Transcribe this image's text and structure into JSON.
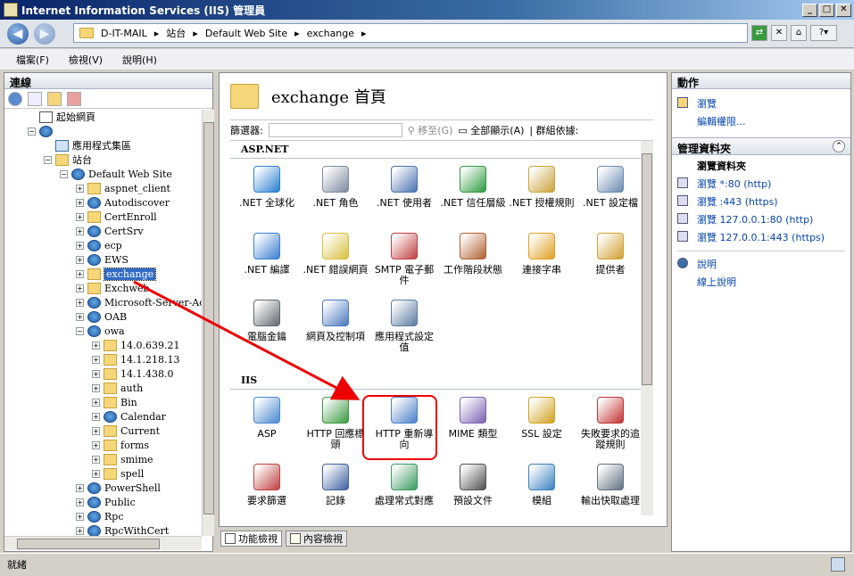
{
  "window": {
    "title": "Internet Information Services (IIS) 管理員",
    "controls": [
      "_",
      "□",
      "✕"
    ]
  },
  "breadcrumb": [
    "D-IT-MAIL",
    "站台",
    "Default Web Site",
    "exchange"
  ],
  "menu": [
    "檔案(F)",
    "檢視(V)",
    "說明(H)"
  ],
  "connections": {
    "title": "連線",
    "tree": [
      {
        "label": "起始網頁",
        "icon": "home",
        "level": 1,
        "exp": ""
      },
      {
        "label": "",
        "icon": "web",
        "level": 1,
        "exp": "−"
      },
      {
        "label": "應用程式集區",
        "icon": "pool",
        "level": 2,
        "exp": ""
      },
      {
        "label": "站台",
        "icon": "fold",
        "level": 2,
        "exp": "−"
      },
      {
        "label": "Default Web Site",
        "icon": "web",
        "level": 3,
        "exp": "−"
      },
      {
        "label": "aspnet_client",
        "icon": "fold",
        "level": 4,
        "exp": "+"
      },
      {
        "label": "Autodiscover",
        "icon": "web",
        "level": 4,
        "exp": "+"
      },
      {
        "label": "CertEnroll",
        "icon": "fold",
        "level": 4,
        "exp": "+"
      },
      {
        "label": "CertSrv",
        "icon": "web",
        "level": 4,
        "exp": "+"
      },
      {
        "label": "ecp",
        "icon": "web",
        "level": 4,
        "exp": "+"
      },
      {
        "label": "EWS",
        "icon": "web",
        "level": 4,
        "exp": "+"
      },
      {
        "label": "exchange",
        "icon": "fold",
        "level": 4,
        "exp": "+",
        "selected": true
      },
      {
        "label": "Exchweb",
        "icon": "fold",
        "level": 4,
        "exp": "+"
      },
      {
        "label": "Microsoft-Server-ActiveS",
        "icon": "web",
        "level": 4,
        "exp": "+"
      },
      {
        "label": "OAB",
        "icon": "web",
        "level": 4,
        "exp": "+"
      },
      {
        "label": "owa",
        "icon": "web",
        "level": 4,
        "exp": "−"
      },
      {
        "label": "14.0.639.21",
        "icon": "fold",
        "level": 5,
        "exp": "+"
      },
      {
        "label": "14.1.218.13",
        "icon": "fold",
        "level": 5,
        "exp": "+"
      },
      {
        "label": "14.1.438.0",
        "icon": "fold",
        "level": 5,
        "exp": "+"
      },
      {
        "label": "auth",
        "icon": "fold",
        "level": 5,
        "exp": "+"
      },
      {
        "label": "Bin",
        "icon": "fold",
        "level": 5,
        "exp": "+"
      },
      {
        "label": "Calendar",
        "icon": "web",
        "level": 5,
        "exp": "+"
      },
      {
        "label": "Current",
        "icon": "fold",
        "level": 5,
        "exp": "+"
      },
      {
        "label": "forms",
        "icon": "fold",
        "level": 5,
        "exp": "+"
      },
      {
        "label": "smime",
        "icon": "fold",
        "level": 5,
        "exp": "+"
      },
      {
        "label": "spell",
        "icon": "fold",
        "level": 5,
        "exp": "+"
      },
      {
        "label": "PowerShell",
        "icon": "web",
        "level": 4,
        "exp": "+"
      },
      {
        "label": "Public",
        "icon": "web",
        "level": 4,
        "exp": "+"
      },
      {
        "label": "Rpc",
        "icon": "web",
        "level": 4,
        "exp": "+"
      },
      {
        "label": "RpcWithCert",
        "icon": "web",
        "level": 4,
        "exp": "+"
      }
    ]
  },
  "center": {
    "title": "exchange 首頁",
    "filter_label": "篩選器:",
    "goto_label": "移至(G)",
    "showall_label": "全部顯示(A)",
    "groupby_label": "群組依據:",
    "sections": [
      {
        "name": "ASP.NET",
        "tiles": [
          {
            "label": ".NET 全球化",
            "color": "#2a7fd0"
          },
          {
            "label": ".NET 角色",
            "color": "#7c8aa0"
          },
          {
            "label": ".NET 使用者",
            "color": "#4a72b0"
          },
          {
            "label": ".NET 信任層級",
            "color": "#2e9a3e"
          },
          {
            "label": ".NET 授權規則",
            "color": "#c9a23a"
          },
          {
            "label": ".NET 設定檔",
            "color": "#6a8ab0"
          },
          {
            "label": ".NET 編譯",
            "color": "#3a7fd0"
          },
          {
            "label": ".NET 錯誤網頁",
            "color": "#d8c040"
          },
          {
            "label": "SMTP 電子郵件",
            "color": "#c04040"
          },
          {
            "label": "工作階段狀態",
            "color": "#b06030"
          },
          {
            "label": "連接字串",
            "color": "#e0a020"
          },
          {
            "label": "提供者",
            "color": "#d0a030"
          },
          {
            "label": "電腦金鑰",
            "color": "#606870"
          },
          {
            "label": "網頁及控制項",
            "color": "#4a78c0"
          },
          {
            "label": "應用程式設定值",
            "color": "#5a7aa0"
          }
        ]
      },
      {
        "name": "IIS",
        "tiles": [
          {
            "label": "ASP",
            "color": "#4a88d0"
          },
          {
            "label": "HTTP 回應標頭",
            "color": "#3a9a40"
          },
          {
            "label": "HTTP 重新導向",
            "color": "#4a80c8"
          },
          {
            "label": "MIME 類型",
            "color": "#7a60b0"
          },
          {
            "label": "SSL 設定",
            "color": "#d0a020"
          },
          {
            "label": "失敗要求的追蹤規則",
            "color": "#c03030"
          },
          {
            "label": "要求篩選",
            "color": "#c04040"
          },
          {
            "label": "記錄",
            "color": "#4060a0"
          },
          {
            "label": "處理常式對應",
            "color": "#3a9a60"
          },
          {
            "label": "預設文件",
            "color": "#505050"
          },
          {
            "label": "模組",
            "color": "#3a80c0"
          },
          {
            "label": "輸出快取處理",
            "color": "#607080"
          }
        ]
      }
    ]
  },
  "viewtabs": [
    {
      "label": "功能檢視"
    },
    {
      "label": "內容檢視"
    }
  ],
  "actions": {
    "title": "動作",
    "browse": "瀏覽",
    "edit_perm": "編輯權限...",
    "manage_title": "管理資料夾",
    "browse_folder": "瀏覽資料夾",
    "browse_links": [
      "瀏覽 *:80 (http)",
      "瀏覽 :443 (https)",
      "瀏覽 127.0.0.1:80 (http)",
      "瀏覽 127.0.0.1:443 (https)"
    ],
    "help": "說明",
    "online_help": "線上說明"
  },
  "status": "就緒"
}
